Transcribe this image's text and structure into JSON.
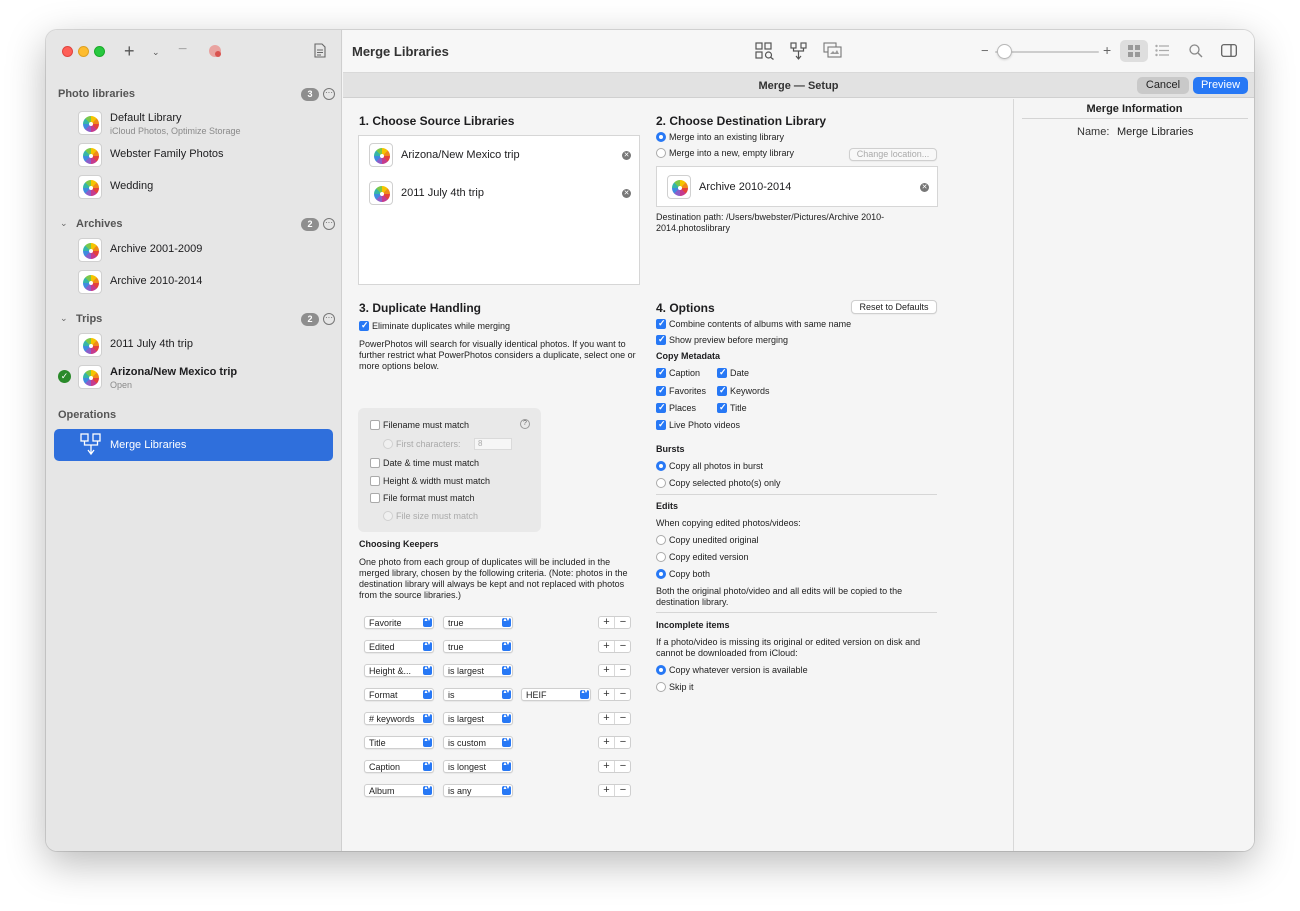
{
  "window": {
    "title": "Merge Libraries",
    "setup_title": "Merge — Setup",
    "cancel_label": "Cancel",
    "preview_label": "Preview"
  },
  "sidebar": {
    "sections": [
      {
        "title": "Photo libraries",
        "count": "3",
        "items": [
          {
            "label": "Default Library",
            "sub": "iCloud Photos, Optimize Storage"
          },
          {
            "label": "Webster Family Photos"
          },
          {
            "label": "Wedding"
          }
        ]
      },
      {
        "title": "Archives",
        "count": "2",
        "items": [
          {
            "label": "Archive 2001-2009"
          },
          {
            "label": "Archive 2010-2014"
          }
        ]
      },
      {
        "title": "Trips",
        "count": "2",
        "items": [
          {
            "label": "2011 July 4th trip"
          },
          {
            "label": "Arizona/New Mexico trip",
            "sub": "Open"
          }
        ]
      }
    ],
    "operations_title": "Operations",
    "operations_item": "Merge Libraries"
  },
  "source": {
    "heading": "1. Choose Source Libraries",
    "libraries": [
      "Arizona/New Mexico trip",
      "2011 July 4th trip"
    ]
  },
  "destination": {
    "heading": "2. Choose Destination Library",
    "option_existing": "Merge into an existing library",
    "option_new": "Merge into a new, empty library",
    "change_location": "Change location...",
    "library": "Archive 2010-2014",
    "path": "Destination path: /Users/bwebster/Pictures/Archive 2010-2014.photoslibrary"
  },
  "duplicates": {
    "heading": "3. Duplicate Handling",
    "eliminate": "Eliminate duplicates while merging",
    "description": "PowerPhotos will search for visually identical photos. If you want to further restrict what PowerPhotos considers a duplicate, select one or more options below.",
    "filename": "Filename must match",
    "first_chars_label": "First characters:",
    "first_chars_value": "8",
    "datetime": "Date & time must match",
    "dimensions": "Height & width must match",
    "format": "File format must match",
    "filesize": "File size must match",
    "keepers_heading": "Choosing Keepers",
    "keepers_text": "One photo from each group of duplicates will be included in the merged library, chosen by the following criteria. (Note: photos in the destination library will always be kept and not replaced with photos from the source libraries.)",
    "rules": [
      {
        "field": "Favorite",
        "op": "true"
      },
      {
        "field": "Edited",
        "op": "true"
      },
      {
        "field": "Height &...",
        "op": "is largest"
      },
      {
        "field": "Format",
        "op": "is",
        "value": "HEIF"
      },
      {
        "field": "# keywords",
        "op": "is largest"
      },
      {
        "field": "Title",
        "op": "is custom"
      },
      {
        "field": "Caption",
        "op": "is longest"
      },
      {
        "field": "Album",
        "op": "is any"
      }
    ]
  },
  "options": {
    "heading": "4. Options",
    "reset": "Reset to Defaults",
    "combine_albums": "Combine contents of albums with same name",
    "show_preview": "Show preview before merging",
    "copy_metadata": "Copy Metadata",
    "caption": "Caption",
    "date": "Date",
    "favorites": "Favorites",
    "keywords": "Keywords",
    "places": "Places",
    "title": "Title",
    "live_photo": "Live Photo videos",
    "bursts": "Bursts",
    "burst_all": "Copy all photos in burst",
    "burst_selected": "Copy selected photo(s) only",
    "edits": "Edits",
    "edits_prompt": "When copying edited photos/videos:",
    "copy_unedited": "Copy unedited original",
    "copy_edited": "Copy edited version",
    "copy_both": "Copy both",
    "edits_note": "Both the original photo/video and all edits will be copied to the destination library.",
    "incomplete": "Incomplete items",
    "incomplete_text": "If a photo/video is missing its original or edited version on disk and cannot be downloaded from iCloud:",
    "copy_whatever": "Copy whatever version is available",
    "skip": "Skip it"
  },
  "inspector": {
    "title": "Merge Information",
    "name_label": "Name:",
    "name_value": "Merge Libraries"
  },
  "colors": {
    "accent": "#2778f5",
    "selection": "#2f6fdc",
    "badge": "#8e8e8e"
  }
}
